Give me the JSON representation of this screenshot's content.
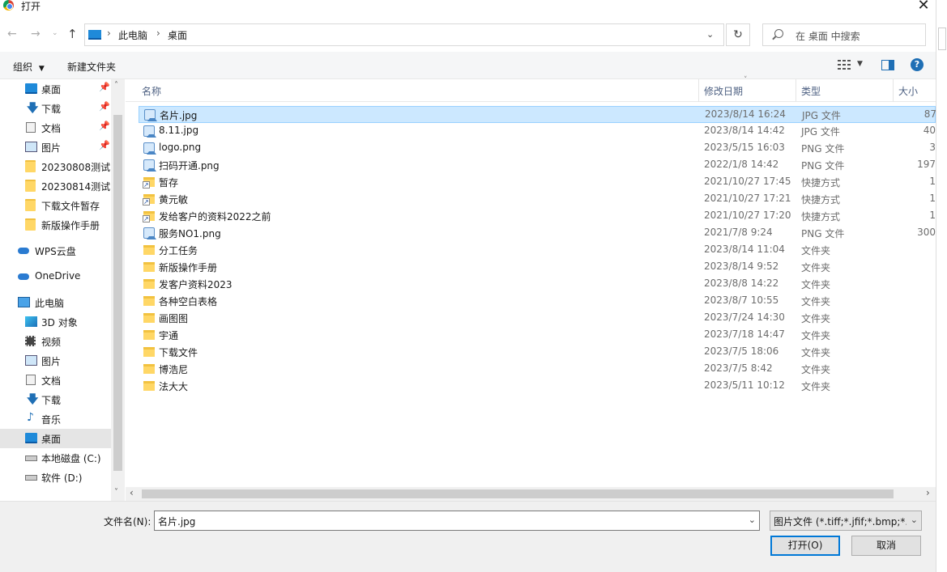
{
  "window": {
    "title": "打开"
  },
  "address": {
    "crumbs": [
      "此电脑",
      "桌面"
    ]
  },
  "search": {
    "placeholder": "在 桌面 中搜索"
  },
  "toolbar": {
    "organize": "组织",
    "new_folder": "新建文件夹"
  },
  "nav": {
    "items": [
      {
        "label": "桌面",
        "icon": "desktop-icon",
        "pinned": true
      },
      {
        "label": "下载",
        "icon": "download-icon",
        "pinned": true
      },
      {
        "label": "文档",
        "icon": "document-icon",
        "pinned": true
      },
      {
        "label": "图片",
        "icon": "pictures-icon",
        "pinned": true
      },
      {
        "label": "20230808测试",
        "icon": "folder-icon"
      },
      {
        "label": "20230814测试",
        "icon": "folder-icon"
      },
      {
        "label": "下载文件暂存",
        "icon": "folder-icon"
      },
      {
        "label": "新版操作手册",
        "icon": "folder-icon"
      },
      {
        "label": "WPS云盘",
        "icon": "cloud-icon"
      },
      {
        "label": "OneDrive",
        "icon": "cloud-icon"
      },
      {
        "label": "此电脑",
        "icon": "computer-icon"
      },
      {
        "label": "3D 对象",
        "icon": "3d-objects-icon"
      },
      {
        "label": "视频",
        "icon": "video-icon"
      },
      {
        "label": "图片",
        "icon": "pictures-icon"
      },
      {
        "label": "文档",
        "icon": "document-icon"
      },
      {
        "label": "下载",
        "icon": "download-icon"
      },
      {
        "label": "音乐",
        "icon": "music-icon"
      },
      {
        "label": "桌面",
        "icon": "desktop-icon",
        "selected": true
      },
      {
        "label": "本地磁盘 (C:)",
        "icon": "drive-icon"
      },
      {
        "label": "软件 (D:)",
        "icon": "drive-icon"
      }
    ]
  },
  "columns": {
    "name": "名称",
    "date": "修改日期",
    "type": "类型",
    "size": "大小"
  },
  "files": [
    {
      "name": "名片.jpg",
      "date": "2023/8/14 16:24",
      "type": "JPG 文件",
      "size": "87",
      "kind": "image",
      "selected": true
    },
    {
      "name": "8.11.jpg",
      "date": "2023/8/14 14:42",
      "type": "JPG 文件",
      "size": "40",
      "kind": "image"
    },
    {
      "name": "logo.png",
      "date": "2023/5/15 16:03",
      "type": "PNG 文件",
      "size": "3",
      "kind": "image"
    },
    {
      "name": "扫码开通.png",
      "date": "2022/1/8 14:42",
      "type": "PNG 文件",
      "size": "197",
      "kind": "image"
    },
    {
      "name": "暂存",
      "date": "2021/10/27 17:45",
      "type": "快捷方式",
      "size": "1",
      "kind": "shortcut"
    },
    {
      "name": "黄元敏",
      "date": "2021/10/27 17:21",
      "type": "快捷方式",
      "size": "1",
      "kind": "shortcut"
    },
    {
      "name": "发给客户的资料2022之前",
      "date": "2021/10/27 17:20",
      "type": "快捷方式",
      "size": "1",
      "kind": "shortcut"
    },
    {
      "name": "服务NO1.png",
      "date": "2021/7/8 9:24",
      "type": "PNG 文件",
      "size": "300",
      "kind": "image"
    },
    {
      "name": "分工任务",
      "date": "2023/8/14 11:04",
      "type": "文件夹",
      "size": "",
      "kind": "folder"
    },
    {
      "name": "新版操作手册",
      "date": "2023/8/14 9:52",
      "type": "文件夹",
      "size": "",
      "kind": "folder"
    },
    {
      "name": "发客户资料2023",
      "date": "2023/8/8 14:22",
      "type": "文件夹",
      "size": "",
      "kind": "folder"
    },
    {
      "name": "各种空白表格",
      "date": "2023/8/7 10:55",
      "type": "文件夹",
      "size": "",
      "kind": "folder"
    },
    {
      "name": "画图图",
      "date": "2023/7/24 14:30",
      "type": "文件夹",
      "size": "",
      "kind": "folder"
    },
    {
      "name": "宇通",
      "date": "2023/7/18 14:47",
      "type": "文件夹",
      "size": "",
      "kind": "folder"
    },
    {
      "name": "下载文件",
      "date": "2023/7/5 18:06",
      "type": "文件夹",
      "size": "",
      "kind": "folder"
    },
    {
      "name": "博浩尼",
      "date": "2023/7/5 8:42",
      "type": "文件夹",
      "size": "",
      "kind": "folder"
    },
    {
      "name": "法大大",
      "date": "2023/5/11 10:12",
      "type": "文件夹",
      "size": "",
      "kind": "folder"
    }
  ],
  "bottom": {
    "filename_label": "文件名(N):",
    "filename_value": "名片.jpg",
    "filter_value": "图片文件 (*.tiff;*.jfif;*.bmp;*.gi",
    "open_label": "打开(O)",
    "cancel_label": "取消"
  }
}
